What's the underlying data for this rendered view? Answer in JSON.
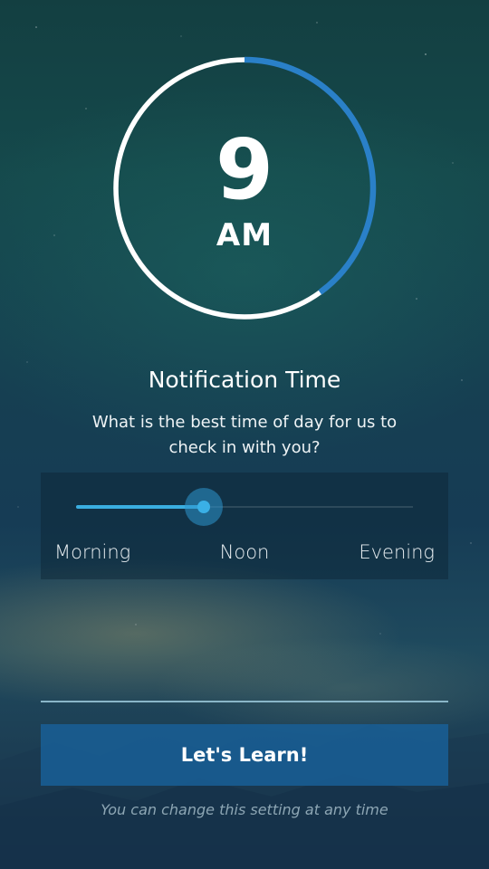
{
  "clock": {
    "hour": "9",
    "period": "AM",
    "ring_progress": 0.4,
    "ring_color": "#2a80c8",
    "ring_base_color": "#ffffff"
  },
  "title": "Notification Time",
  "subtitle": "What is the best time of day for us to check in with you?",
  "slider": {
    "value": 0.38,
    "labels": {
      "start": "Morning",
      "middle": "Noon",
      "end": "Evening"
    },
    "accent_color": "#3aaee0"
  },
  "cta": {
    "label": "Let's Learn!",
    "color": "#195f96"
  },
  "footnote": "You can change this setting at any time"
}
